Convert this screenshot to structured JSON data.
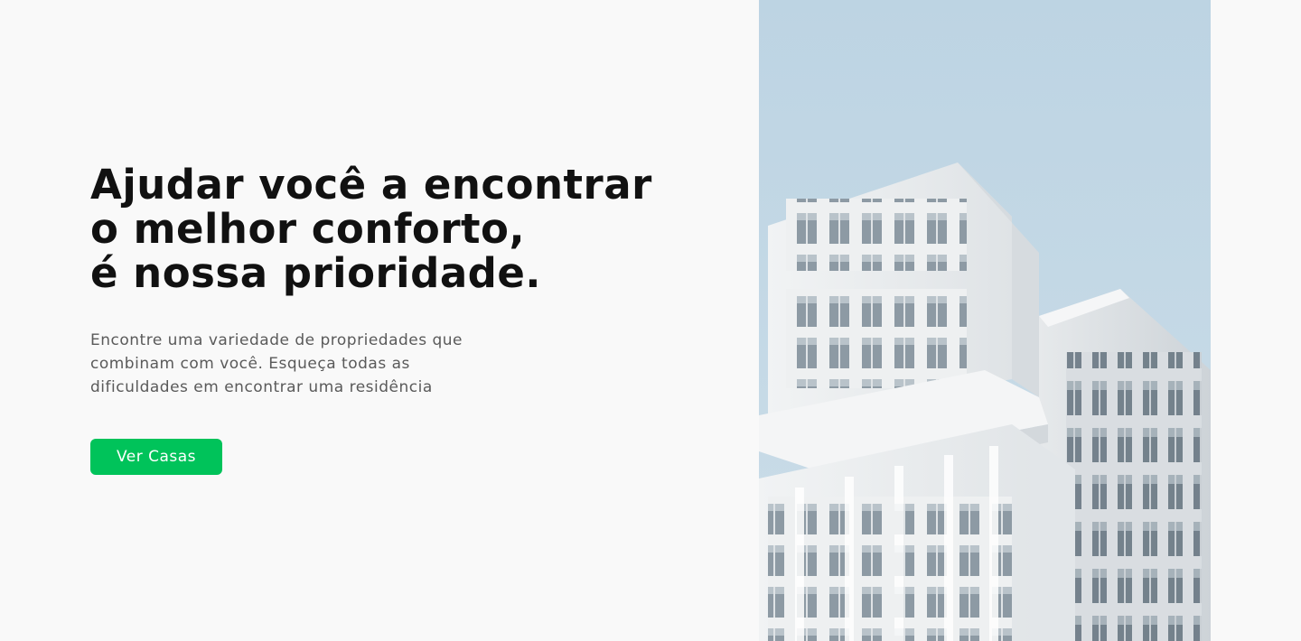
{
  "hero": {
    "headline_lines": [
      "Ajudar você a encontrar",
      "o melhor conforto,",
      "é nossa prioridade."
    ],
    "subtitle_lines": [
      "Encontre uma variedade de propriedades que",
      "combinam com você. Esqueça todas as",
      "dificuldades em encontrar uma residência"
    ],
    "cta_label": "Ver Casas"
  },
  "colors": {
    "background": "#f9f9f9",
    "headline": "#111111",
    "subtitle": "#5a5a5a",
    "accent": "#00c35a",
    "sky": "#c4d9e6"
  },
  "image": {
    "subject": "building-photo"
  }
}
